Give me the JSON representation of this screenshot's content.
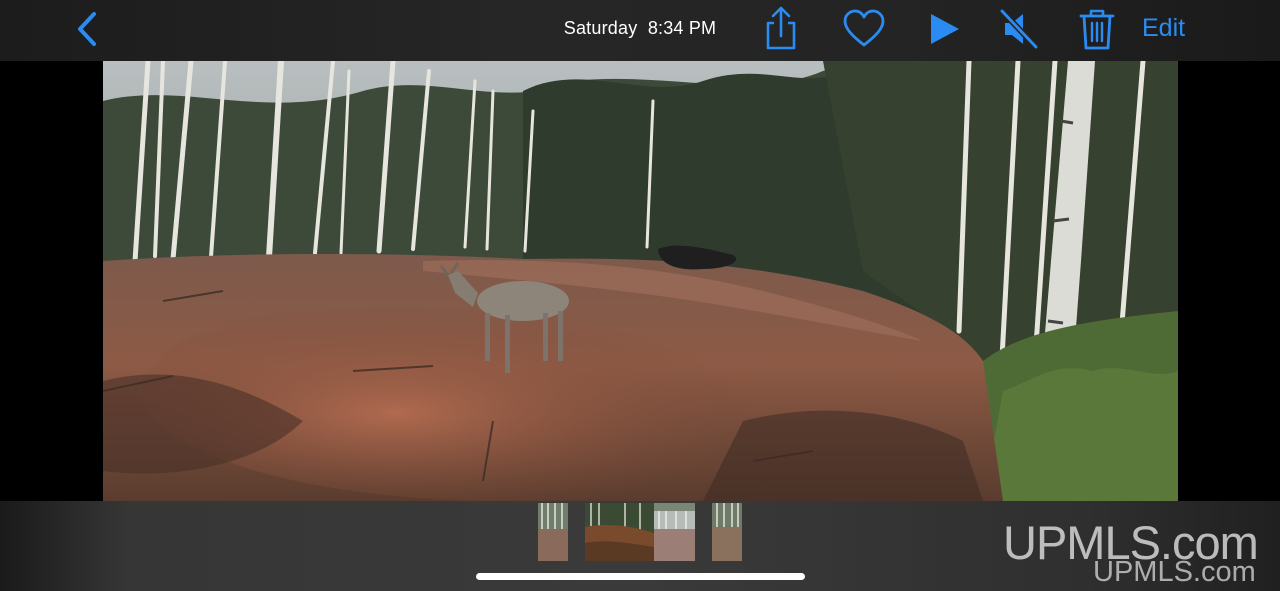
{
  "header": {
    "day": "Saturday",
    "time": "8:34 PM",
    "edit_label": "Edit"
  },
  "icons": {
    "back": "chevron-left-icon",
    "share": "share-icon",
    "favorite": "heart-icon",
    "play": "play-icon",
    "mute": "speaker-muted-icon",
    "delete": "trash-icon"
  },
  "colors": {
    "accent": "#2a8cf2",
    "bar_background": "#242424"
  },
  "watermark": {
    "large": "UPMLS.com",
    "small": "UPMLS.com"
  }
}
